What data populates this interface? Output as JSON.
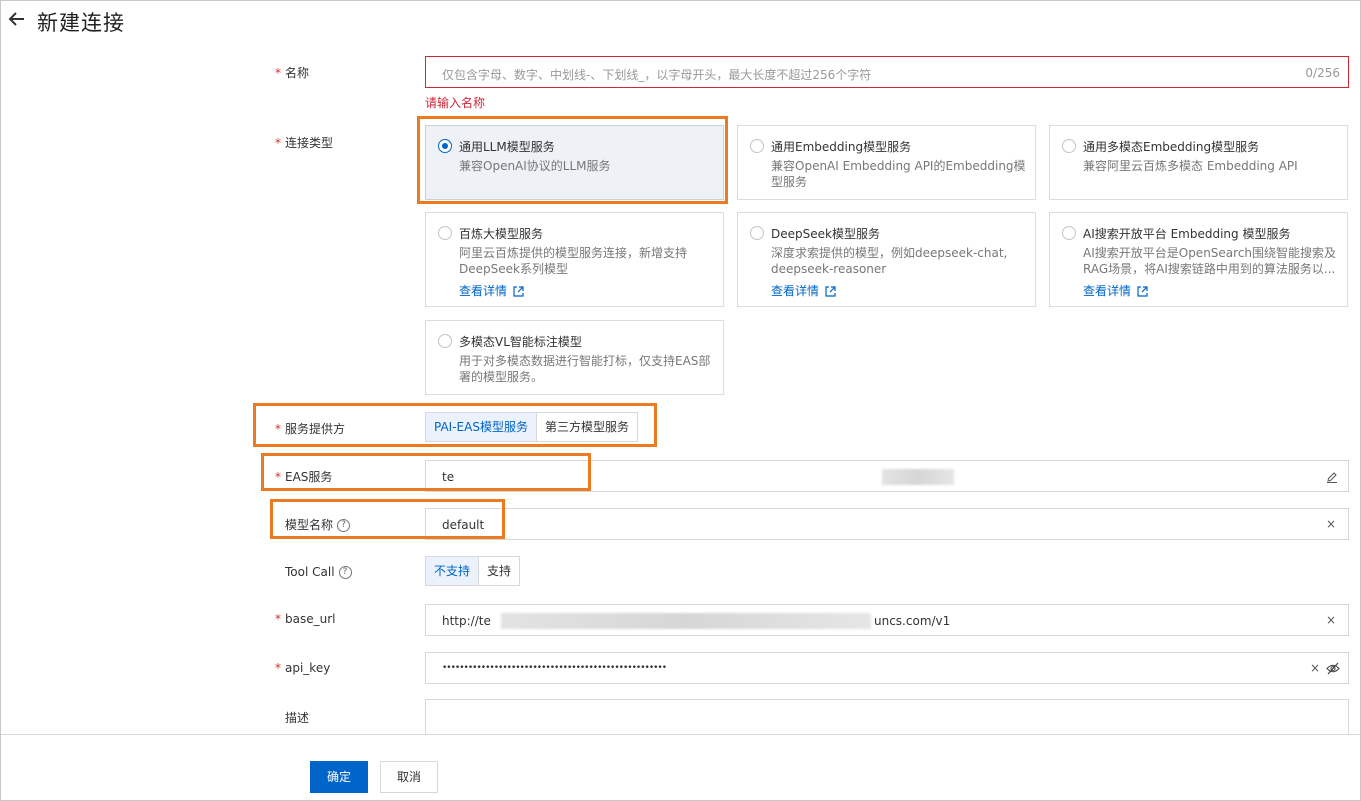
{
  "header": {
    "title": "新建连接"
  },
  "form": {
    "name": {
      "label": "名称",
      "required": "*",
      "placeholder": "仅包含字母、数字、中划线-、下划线_，以字母开头，最大长度不超过256个字符",
      "counter": "0/256",
      "error": "请输入名称"
    },
    "type": {
      "label": "连接类型",
      "required": "*",
      "cards": [
        {
          "title": "通用LLM模型服务",
          "desc": "兼容OpenAI协议的LLM服务",
          "selected": true
        },
        {
          "title": "通用Embedding模型服务",
          "desc": "兼容OpenAI Embedding API的Embedding模型服务"
        },
        {
          "title": "通用多模态Embedding模型服务",
          "desc": "兼容阿里云百炼多模态 Embedding API"
        },
        {
          "title": "百炼大模型服务",
          "desc": "阿里云百炼提供的模型服务连接，新增支持DeepSeek系列模型",
          "link": "查看详情"
        },
        {
          "title": "DeepSeek模型服务",
          "desc": "深度求索提供的模型，例如deepseek-chat, deepseek-reasoner",
          "link": "查看详情"
        },
        {
          "title": "AI搜索开放平台 Embedding 模型服务",
          "desc": "AI搜索开放平台是OpenSearch围绕智能搜索及RAG场景，将AI搜索链路中用到的算法服务以...",
          "link": "查看详情"
        },
        {
          "title": "多模态VL智能标注模型",
          "desc": "用于对多模态数据进行智能打标，仅支持EAS部署的模型服务。"
        }
      ]
    },
    "provider": {
      "label": "服务提供方",
      "required": "*",
      "options": [
        "PAI-EAS模型服务",
        "第三方模型服务"
      ],
      "selected": "PAI-EAS模型服务"
    },
    "eas": {
      "label": "EAS服务",
      "required": "*",
      "value": "te"
    },
    "model_name": {
      "label": "模型名称",
      "help": "?",
      "value": "default",
      "clear": "×"
    },
    "tool_call": {
      "label": "Tool Call",
      "help": "?",
      "options": [
        "不支持",
        "支持"
      ],
      "selected": "不支持"
    },
    "base_url": {
      "label": "base_url",
      "required": "*",
      "value_start": "http://te",
      "value_end": "uncs.com/v1",
      "clear": "×"
    },
    "api_key": {
      "label": "api_key",
      "required": "*",
      "value": "••••••••••••••••••••••••••••••••••••••••••••••••••••",
      "clear": "×"
    },
    "description": {
      "label": "描述"
    }
  },
  "footer": {
    "confirm": "确定",
    "cancel": "取消"
  },
  "colors": {
    "primary": "#0064c8",
    "highlight": "#ec7a20",
    "error": "#d0283a"
  },
  "icons": [
    "arrow-left-icon",
    "edit-icon",
    "eye-off-icon",
    "external-link-icon",
    "help-icon",
    "clear-icon"
  ]
}
